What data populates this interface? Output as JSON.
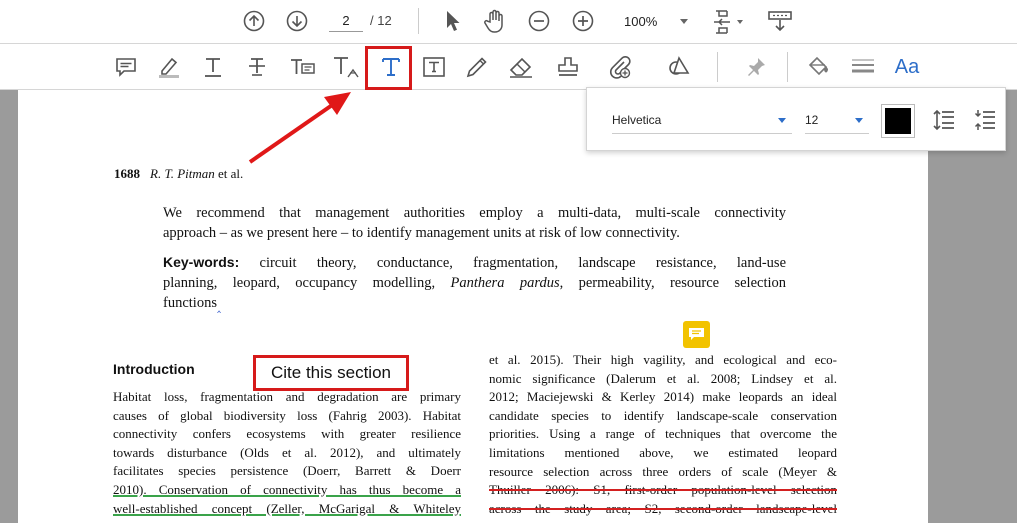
{
  "top_toolbar": {
    "current_page": "2",
    "total_pages": "/ 12",
    "zoom": "100%",
    "icons": [
      "page-up-icon",
      "page-down-icon",
      "select-pointer-icon",
      "hand-pan-icon",
      "zoom-out-icon",
      "zoom-in-icon",
      "page-fit-icon",
      "export-icon"
    ]
  },
  "annotation_toolbar": {
    "icons": [
      "comment-icon",
      "highlight-icon",
      "underline-text-icon",
      "strikethrough-text-icon",
      "replace-text-icon",
      "insert-text-icon",
      "add-text-icon",
      "text-box-icon",
      "pencil-icon",
      "eraser-icon",
      "stamp-icon",
      "attach-file-icon",
      "shapes-icon",
      "pin-icon",
      "fill-color-icon",
      "line-weight-icon",
      "text-properties-icon"
    ],
    "text_properties_label": "Aa"
  },
  "text_properties": {
    "font": "Helvetica",
    "size": "12",
    "color": "#000000"
  },
  "document": {
    "page_number": "1688",
    "authors": "R. T. Pitman",
    "authors_suffix": "et al.",
    "abstract_end": [
      "We recommend that management authorities employ a multi-data, multi-scale connectivity",
      "approach – as we present here – to identify management units at risk of low connectivity."
    ],
    "keywords_label": "Key-words:",
    "keywords_lines": [
      "circuit theory, conductance, fragmentation, landscape resistance, land-use",
      "planning, leopard, occupancy modelling,",
      "functions"
    ],
    "keywords_italic": "Panthera pardus",
    "keywords_line2_end": ", permeability, resource selection",
    "intro_heading": "Introduction",
    "left_column": [
      "Habitat loss, fragmentation and degradation are primary",
      "causes of global biodiversity loss (Fahrig 2003). Habitat",
      "connectivity confers ecosystems with greater resilience",
      "towards disturbance (Olds et al. 2012), and ultimately",
      "facilitates species persistence (Doerr, Barrett & Doerr",
      "2010). Conservation of connectivity has thus become a",
      "well-established concept (Zeller, McGarigal & Whiteley"
    ],
    "right_column": [
      "et al. 2015). Their high vagility, and ecological and eco-",
      "nomic significance (Dalerum et al. 2008; Lindsey et al.",
      "2012; Maciejewski & Kerley 2014) make leopards an ideal",
      "candidate species to identify landscape-scale conservation",
      "priorities. Using a range of techniques that overcome the",
      "limitations mentioned above, we estimated leopard",
      "resource selection across three orders of scale (Meyer &",
      "Thuiller 2006): S1, first-order population-level selection",
      "across the study area; S2, second-order landscape-level"
    ]
  },
  "callout_label": "Cite this section",
  "colors": {
    "callout_red": "#d61a1a",
    "accent_blue": "#2d6ec9",
    "sticky_yellow": "#f2c300",
    "underline_green": "#3aa34a",
    "strike_red": "#d32020"
  }
}
